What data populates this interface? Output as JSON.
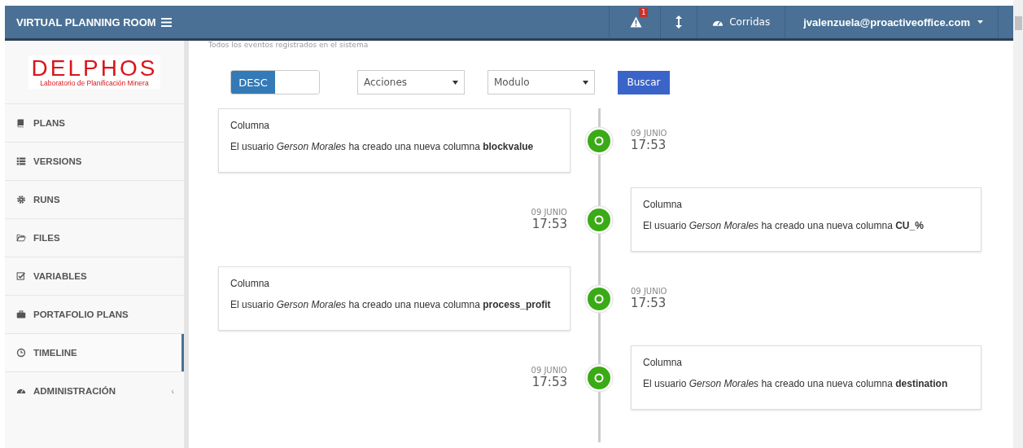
{
  "header": {
    "title": "VIRTUAL PLANNING ROOM",
    "alerts_badge": "1",
    "runs_label": "Corridas",
    "user": "jvalenzuela@proactiveoffice.com"
  },
  "logo": {
    "name": "DELPHOS",
    "subtitle": "Laboratorio de Planificación Minera"
  },
  "sidebar": {
    "items": [
      {
        "label": "PLANS",
        "selected": false
      },
      {
        "label": "VERSIONS",
        "selected": false
      },
      {
        "label": "RUNS",
        "selected": false
      },
      {
        "label": "FILES",
        "selected": false
      },
      {
        "label": "VARIABLES",
        "selected": false
      },
      {
        "label": "PORTAFOLIO PLANS",
        "selected": false
      },
      {
        "label": "TIMELINE",
        "selected": true
      },
      {
        "label": "ADMINISTRACIÓN",
        "selected": false,
        "chevron": "‹"
      }
    ]
  },
  "subtitle": "Todos los eventos registrados en el sistema",
  "filters": {
    "sort_toggle": {
      "label": "DESC",
      "on": true
    },
    "actions_select": "Acciones",
    "module_select": "Modulo",
    "search_button": "Buscar"
  },
  "events": [
    {
      "kind": "left",
      "title": "Columna",
      "text": "El usuario *Gerson Morales* ha creado una nueva columna **blockvalue**",
      "date": "09 JUNIO",
      "time": "17:53"
    },
    {
      "kind": "right",
      "title": "Columna",
      "text": "El usuario *Gerson Morales* ha creado una nueva columna **CU_%**",
      "date": "09 JUNIO",
      "time": "17:53"
    },
    {
      "kind": "left",
      "title": "Columna",
      "text": "El usuario *Gerson Morales* ha creado una nueva columna **process_profit**",
      "date": "09 JUNIO",
      "time": "17:53"
    },
    {
      "kind": "right",
      "title": "Columna",
      "text": "El usuario *Gerson Morales* ha creado una nueva columna **destination**",
      "date": "09 JUNIO",
      "time": "17:53"
    }
  ]
}
